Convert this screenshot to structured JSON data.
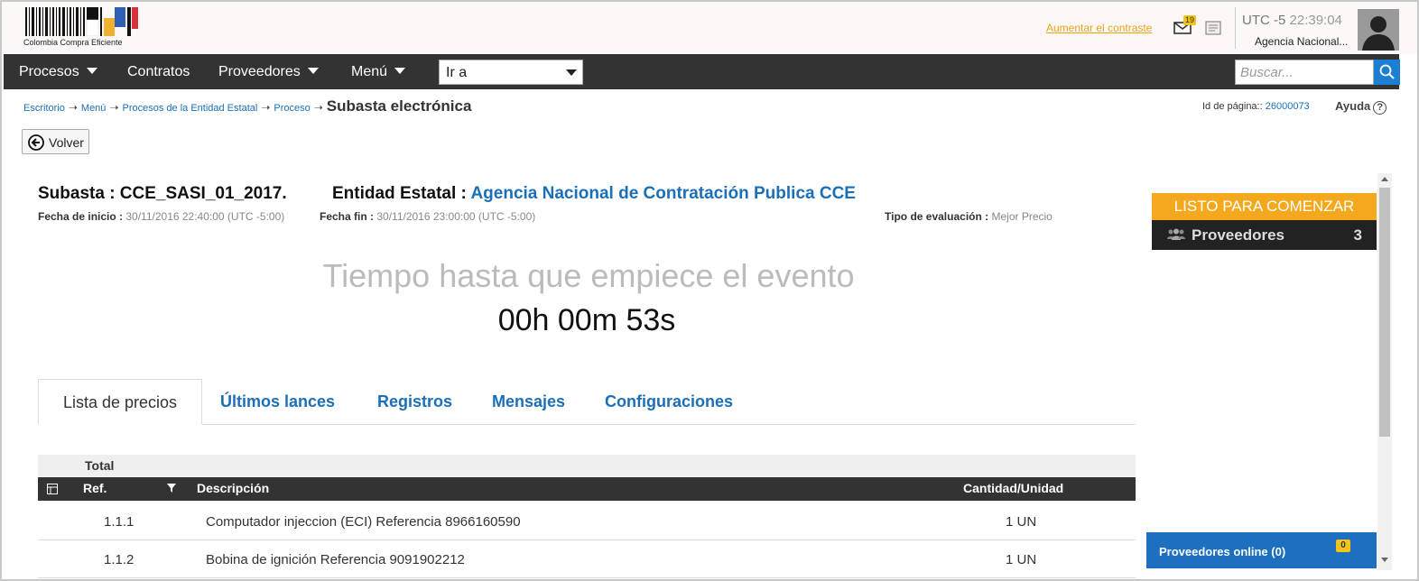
{
  "header": {
    "logo_text": "Colombia Compra Eficiente",
    "contrast_link": "Aumentar el contraste",
    "mail_count": "19",
    "utc_label": "UTC -5",
    "time": "22:39:04",
    "agency_short": "Agencia Nacional..."
  },
  "nav": {
    "items": [
      "Procesos",
      "Contratos",
      "Proveedores",
      "Menú"
    ],
    "goto_value": "Ir a",
    "search_placeholder": "Buscar..."
  },
  "breadcrumb": {
    "items": [
      "Escritorio",
      "Menú",
      "Procesos de la Entidad Estatal",
      "Proceso"
    ],
    "current": "Subasta electrónica"
  },
  "page_id": {
    "label": "Id de página::",
    "value": "26000073"
  },
  "help_label": "Ayuda",
  "back_label": "Volver",
  "auction": {
    "title": "Subasta : CCE_SASI_01_2017.",
    "entity_label": "Entidad Estatal :",
    "entity_value": "Agencia Nacional de Contratación Publica CCE",
    "start_label": "Fecha de inicio :",
    "start_value": "30/11/2016 22:40:00 (UTC -5:00)",
    "end_label": "Fecha fin :",
    "end_value": "30/11/2016 23:00:00 (UTC -5:00)",
    "eval_label": "Tipo de evaluación :",
    "eval_value": "Mejor Precio",
    "countdown_label": "Tiempo hasta que empiece el evento",
    "countdown": "00h 00m 53s"
  },
  "tabs": [
    "Lista de precios",
    "Últimos lances",
    "Registros",
    "Mensajes",
    "Configuraciones"
  ],
  "table": {
    "total_label": "Total",
    "columns": [
      "Ref.",
      "Descripción",
      "Cantidad/Unidad"
    ],
    "rows": [
      {
        "ref": "1.1.1",
        "desc": "Computador injeccion (ECI) Referencia 8966160590",
        "qty": "1 UN"
      },
      {
        "ref": "1.1.2",
        "desc": "Bobina de ignición Referencia 9091902212",
        "qty": "1 UN"
      }
    ]
  },
  "status_panel": {
    "state": "LISTO PARA COMENZAR",
    "providers_label": "Proveedores",
    "providers_count": "3"
  },
  "online": {
    "label": "Proveedores online (0)",
    "badge": "0"
  },
  "colors": {
    "nav_bg": "#333333",
    "accent_blue": "#1a6fb8",
    "status_orange": "#f4a81d",
    "online_blue": "#1d6fc0"
  }
}
